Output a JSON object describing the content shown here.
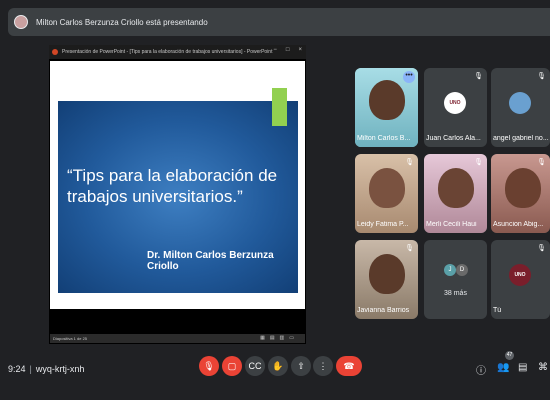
{
  "banner": {
    "presenter_text": "Milton Carlos Berzunza Criollo está presentando"
  },
  "presentation": {
    "window_title": "Presentación de PowerPoint - [Tips para la elaboración de trabajos universitarios] - PowerPoint",
    "slide_title": "“Tips para la elaboración de trabajos universitarios.”",
    "slide_author": "Dr. Milton Carlos Berzunza Criollo",
    "status_text": "Diapositiva 1 de 25"
  },
  "participants": [
    {
      "name": "Milton Carlos B..."
    },
    {
      "name": "Juan Carlos Ala..."
    },
    {
      "name": "angel gabriel no..."
    },
    {
      "name": "Leidy Fatima P..."
    },
    {
      "name": "Merli Cecili Haui"
    },
    {
      "name": "Asuncion Abig..."
    },
    {
      "name": "Javianna Barrios"
    },
    {
      "name": "38 más"
    },
    {
      "name": "Tú"
    }
  ],
  "logo_text": "UNO",
  "footer": {
    "time": "9:24",
    "meeting_code": "wyq-krtj-xnh",
    "participants_badge": "47"
  },
  "colors": {
    "danger": "#ea4335",
    "accent": "#8ab4f8",
    "slide_green": "#92d050"
  }
}
